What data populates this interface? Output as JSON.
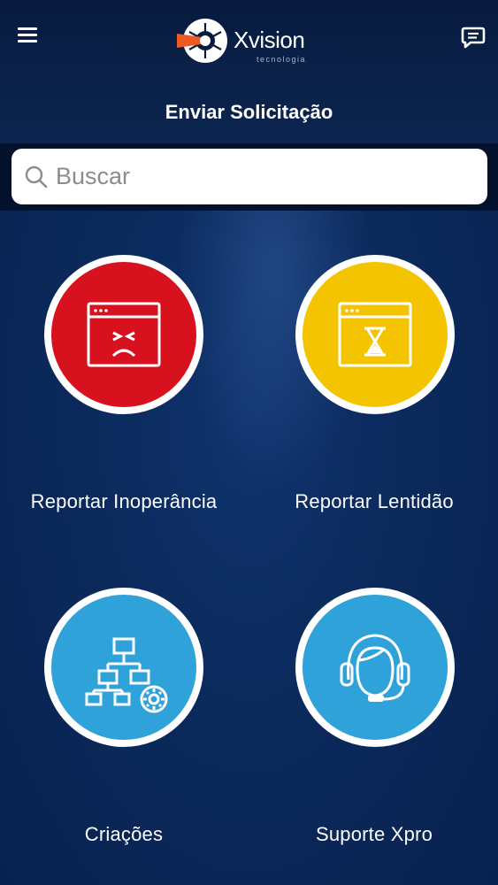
{
  "header": {
    "brand_name": "Xvision",
    "brand_tagline": "tecnologia",
    "menu_icon": "hamburger-menu-icon",
    "chat_icon": "chat-bubble-icon"
  },
  "page": {
    "title": "Enviar Solicitação"
  },
  "search": {
    "placeholder": "Buscar",
    "value": "",
    "icon": "search-icon"
  },
  "tiles": [
    {
      "label": "Reportar Inoperância",
      "icon": "error-window-icon",
      "color": "#d7111d"
    },
    {
      "label": "Reportar Lentidão",
      "icon": "hourglass-window-icon",
      "color": "#f5c400"
    },
    {
      "label": "Criações",
      "icon": "sitemap-gear-icon",
      "color": "#2fa3d9"
    },
    {
      "label": "Suporte Xpro",
      "icon": "headset-agent-icon",
      "color": "#2fa3d9"
    }
  ],
  "colors": {
    "background": "#0a2555",
    "search_bar": "#03112c",
    "orange_accent": "#ee5a24"
  }
}
